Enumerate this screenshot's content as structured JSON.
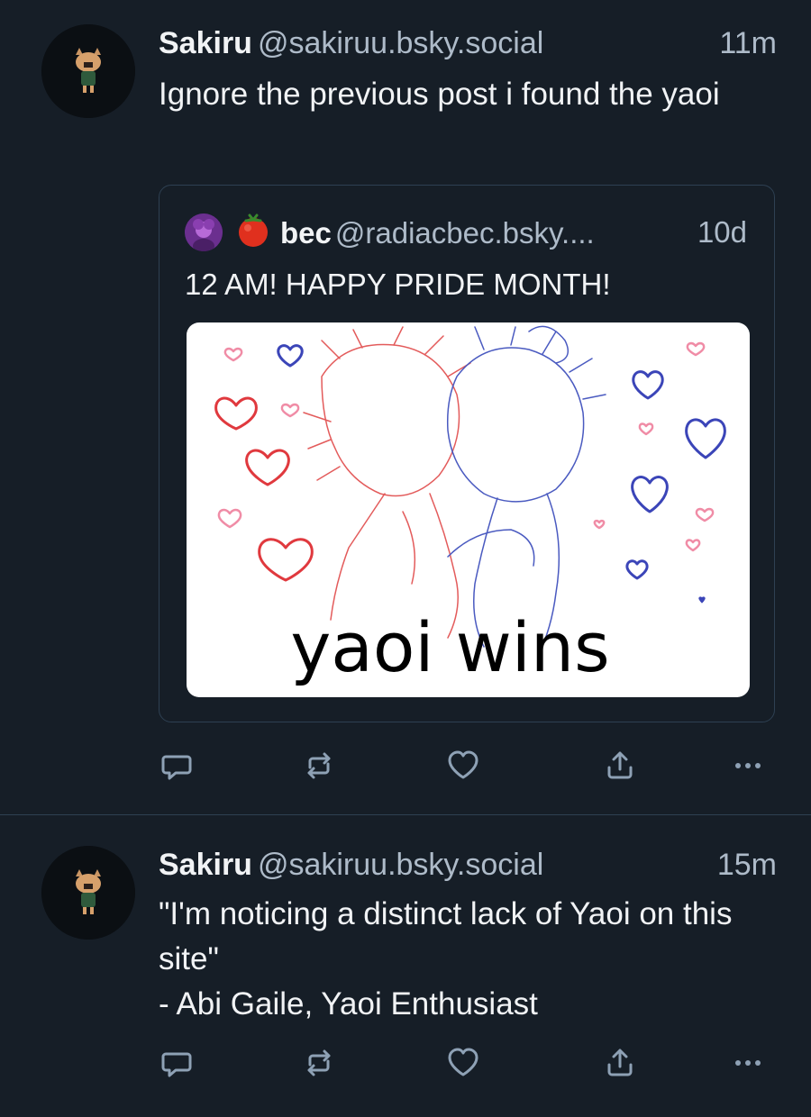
{
  "posts": [
    {
      "author": {
        "display_name": "Sakiru",
        "handle": "@sakiruu.bsky.social"
      },
      "time": "11m",
      "text_lines": [
        "Ignore the previous post i found the yaoi"
      ],
      "quote": {
        "author": {
          "display_name": "bec",
          "handle": "@radiacbec.bsky....",
          "emoji": "🍅"
        },
        "time": "10d",
        "text": "12 AM! HAPPY PRIDE MONTH!",
        "image_caption": "yaoi wins"
      },
      "actions": [
        "reply-icon",
        "repost-icon",
        "like-icon",
        "share-icon",
        "more-icon"
      ]
    },
    {
      "author": {
        "display_name": "Sakiru",
        "handle": "@sakiruu.bsky.social"
      },
      "time": "15m",
      "text_lines": [
        "\"I'm noticing a distinct lack of Yaoi on this site\"",
        "- Abi Gaile, Yaoi Enthusiast"
      ],
      "actions": [
        "reply-icon",
        "repost-icon",
        "like-icon",
        "share-icon",
        "more-icon"
      ]
    }
  ],
  "colors": {
    "background": "#161e27",
    "text": "#f1f3f5",
    "muted": "#aebbc9",
    "border": "#2e4052",
    "icon": "#8ea1b5"
  }
}
